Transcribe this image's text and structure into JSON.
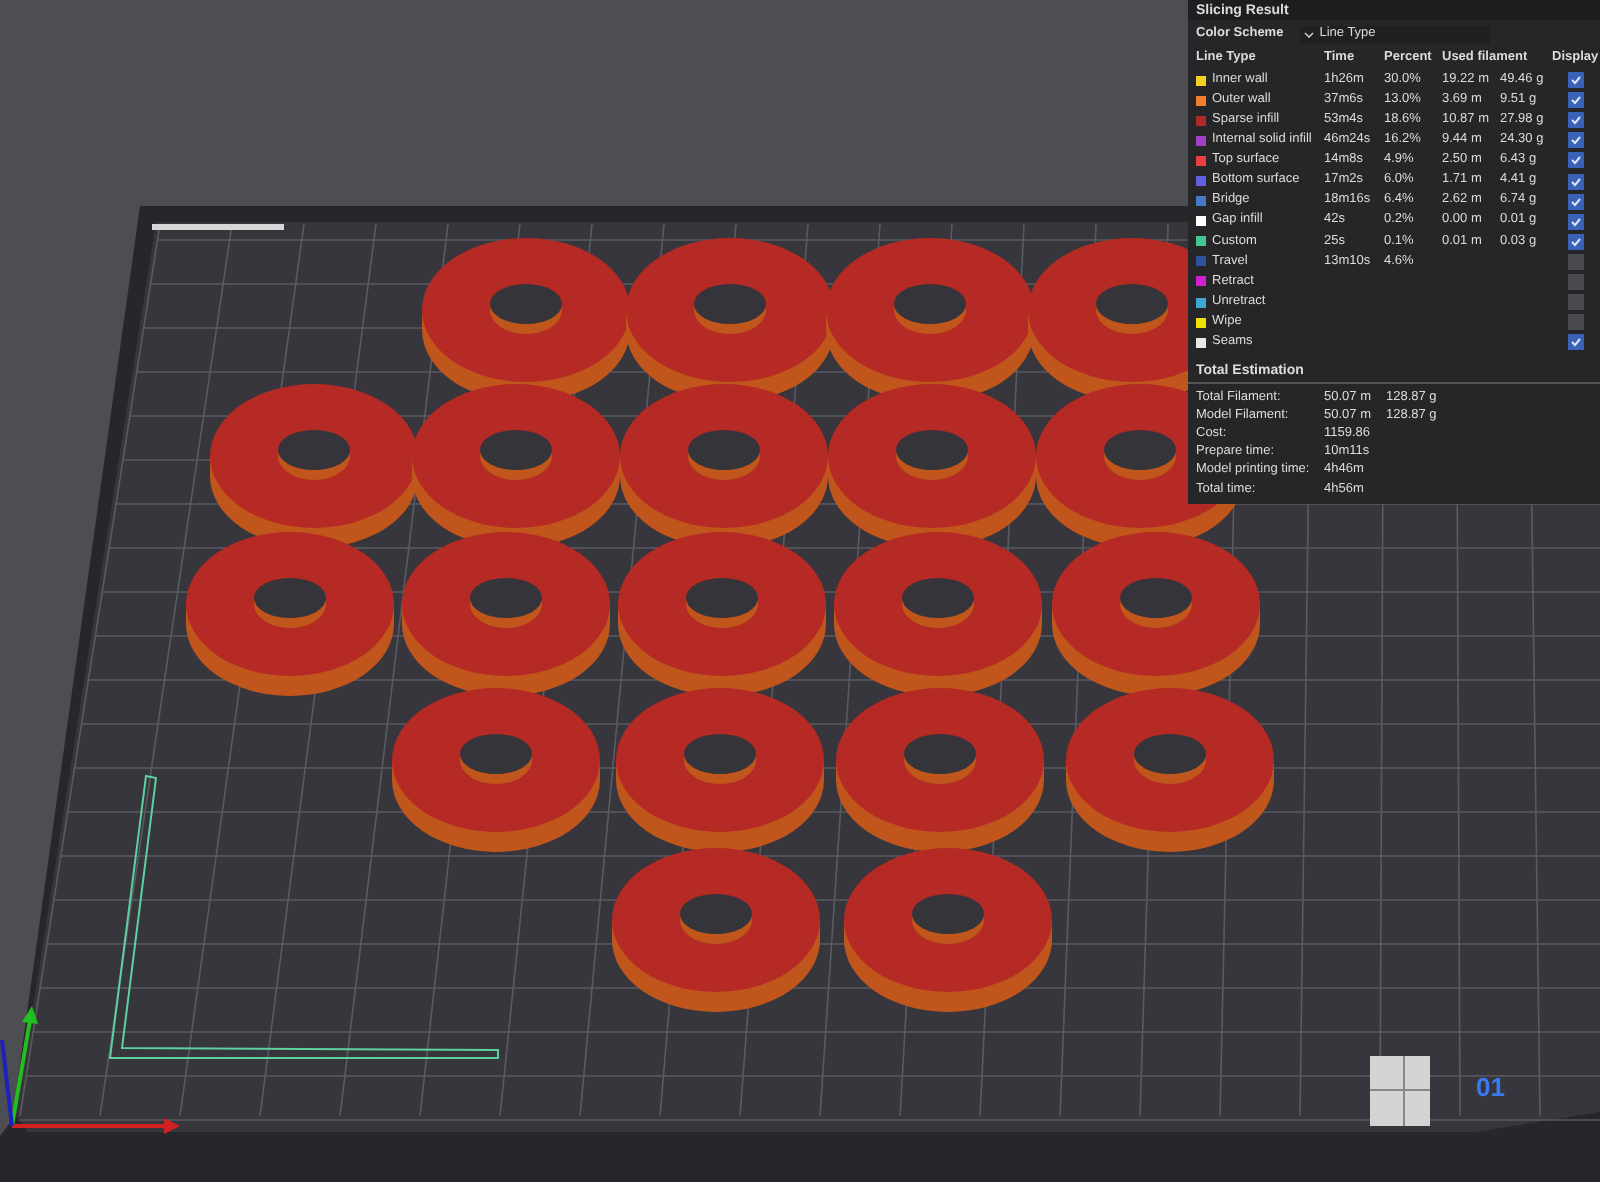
{
  "plate_label": "01",
  "slicing_result": {
    "title": "Slicing Result",
    "color_scheme": {
      "label": "Color Scheme",
      "value": "Line Type"
    },
    "columns": [
      "Line Type",
      "Time",
      "Percent",
      "Used filament",
      "Display"
    ],
    "rows": [
      {
        "name": "Inner wall",
        "color": "#f2d21f",
        "time": "1h26m",
        "percent": "30.0%",
        "length": "19.22 m",
        "weight": "49.46 g",
        "display": true
      },
      {
        "name": "Outer wall",
        "color": "#f08030",
        "time": "37m6s",
        "percent": "13.0%",
        "length": "3.69 m",
        "weight": "9.51 g",
        "display": true
      },
      {
        "name": "Sparse infill",
        "color": "#b02828",
        "time": "53m4s",
        "percent": "18.6%",
        "length": "10.87 m",
        "weight": "27.98 g",
        "display": true
      },
      {
        "name": "Internal solid infill",
        "color": "#a040c8",
        "time": "46m24s",
        "percent": "16.2%",
        "length": "9.44 m",
        "weight": "24.30 g",
        "display": true
      },
      {
        "name": "Top surface",
        "color": "#e84040",
        "time": "14m8s",
        "percent": "4.9%",
        "length": "2.50 m",
        "weight": "6.43 g",
        "display": true
      },
      {
        "name": "Bottom surface",
        "color": "#6060e0",
        "time": "17m2s",
        "percent": "6.0%",
        "length": "1.71 m",
        "weight": "4.41 g",
        "display": true
      },
      {
        "name": "Bridge",
        "color": "#4878c8",
        "time": "18m16s",
        "percent": "6.4%",
        "length": "2.62 m",
        "weight": "6.74 g",
        "display": true
      },
      {
        "name": "Gap infill",
        "color": "#ffffff",
        "time": "42s",
        "percent": "0.2%",
        "length": "0.00 m",
        "weight": "0.01 g",
        "display": true
      },
      {
        "name": "Custom",
        "color": "#40c890",
        "time": "25s",
        "percent": "0.1%",
        "length": "0.01 m",
        "weight": "0.03 g",
        "display": true
      },
      {
        "name": "Travel",
        "color": "#3050a0",
        "time": "13m10s",
        "percent": "4.6%",
        "display": false
      },
      {
        "name": "Retract",
        "color": "#d020d0",
        "display": false
      },
      {
        "name": "Unretract",
        "color": "#40a8d0",
        "display": false
      },
      {
        "name": "Wipe",
        "color": "#f0e000",
        "display": false
      },
      {
        "name": "Seams",
        "color": "#e8e8e8",
        "display": true
      }
    ],
    "total_estimation": {
      "title": "Total Estimation",
      "rows": [
        {
          "label": "Total Filament:",
          "value": "50.07 m",
          "extra": "128.87 g"
        },
        {
          "label": "Model Filament:",
          "value": "50.07 m",
          "extra": "128.87 g"
        },
        {
          "label": "Cost:",
          "value": "1159.86"
        },
        {
          "label": "Prepare time:",
          "value": "10m11s"
        },
        {
          "label": "Model printing time:",
          "value": "4h46m"
        },
        {
          "label": "Total time:",
          "value": "4h56m"
        }
      ]
    }
  }
}
